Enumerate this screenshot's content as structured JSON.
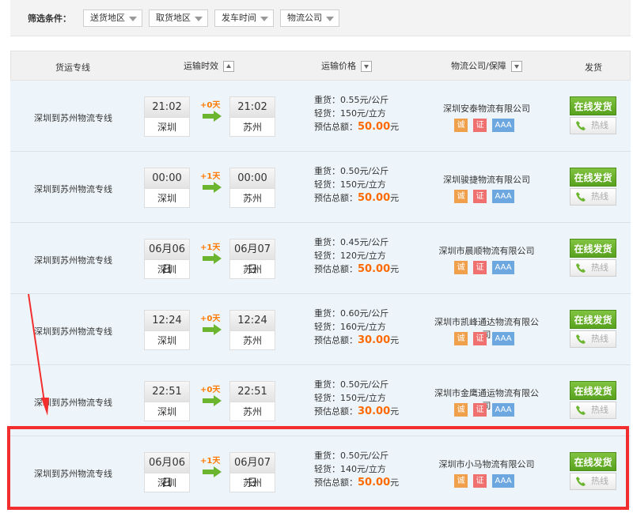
{
  "filters": {
    "label": "筛选条件：",
    "selects": [
      "送货地区",
      "取货地区",
      "发车时间",
      "物流公司"
    ]
  },
  "table": {
    "headers": {
      "route": "货运专线",
      "time": "运输时效",
      "price": "运输价格",
      "company": "物流公司/保障",
      "ship": "发货"
    },
    "labels": {
      "heavy": "重货：",
      "light": "轻货：",
      "total": "预估总额：",
      "yuan": "元",
      "ship_button": "在线发货",
      "hotline_button": "热线",
      "badge_cheng": "诚",
      "badge_zheng": "证",
      "badge_aaa": "AAA"
    },
    "rows": [
      {
        "route": "深圳到苏州物流专线",
        "depart_time": "21:02",
        "depart_city": "深圳",
        "days": "+0天",
        "arrive_time": "21:02",
        "arrive_city": "苏州",
        "heavy": "0.55元/公斤",
        "light": "150元/立方",
        "total": "50.00",
        "company": "深圳安泰物流有限公司"
      },
      {
        "route": "深圳到苏州物流专线",
        "depart_time": "00:00",
        "depart_city": "深圳",
        "days": "+1天",
        "arrive_time": "00:00",
        "arrive_city": "苏州",
        "heavy": "0.50元/公斤",
        "light": "150元/立方",
        "total": "50.00",
        "company": "深圳骏捷物流有限公司"
      },
      {
        "route": "深圳到苏州物流专线",
        "depart_time": "06月06日",
        "depart_city": "深圳",
        "days": "+1天",
        "arrive_time": "06月07日",
        "arrive_city": "苏州",
        "heavy": "0.45元/公斤",
        "light": "120元/立方",
        "total": "50.00",
        "company": "深圳市晨顺物流有限公司"
      },
      {
        "route": "深圳到苏州物流专线",
        "depart_time": "12:24",
        "depart_city": "深圳",
        "days": "+0天",
        "arrive_time": "12:24",
        "arrive_city": "苏州",
        "heavy": "0.60元/公斤",
        "light": "160元/立方",
        "total": "30.00",
        "company": "深圳市凯峰通达物流有限公司"
      },
      {
        "route": "深圳到苏州物流专线",
        "depart_time": "22:51",
        "depart_city": "深圳",
        "days": "+0天",
        "arrive_time": "22:51",
        "arrive_city": "苏州",
        "heavy": "0.50元/公斤",
        "light": "150元/立方",
        "total": "30.00",
        "company": "深圳市金鹰通运物流有限公司"
      },
      {
        "route": "深圳到苏州物流专线",
        "depart_time": "06月06日",
        "depart_city": "深圳",
        "days": "+1天",
        "arrive_time": "06月07日",
        "arrive_city": "苏州",
        "heavy": "0.50元/公斤",
        "light": "140元/立方",
        "total": "50.00",
        "company": "深圳市小马物流有限公司"
      }
    ]
  },
  "colors": {
    "highlight": "#f32e2e",
    "ship_button": "#6bb52f",
    "total_price": "#ff6a00"
  }
}
